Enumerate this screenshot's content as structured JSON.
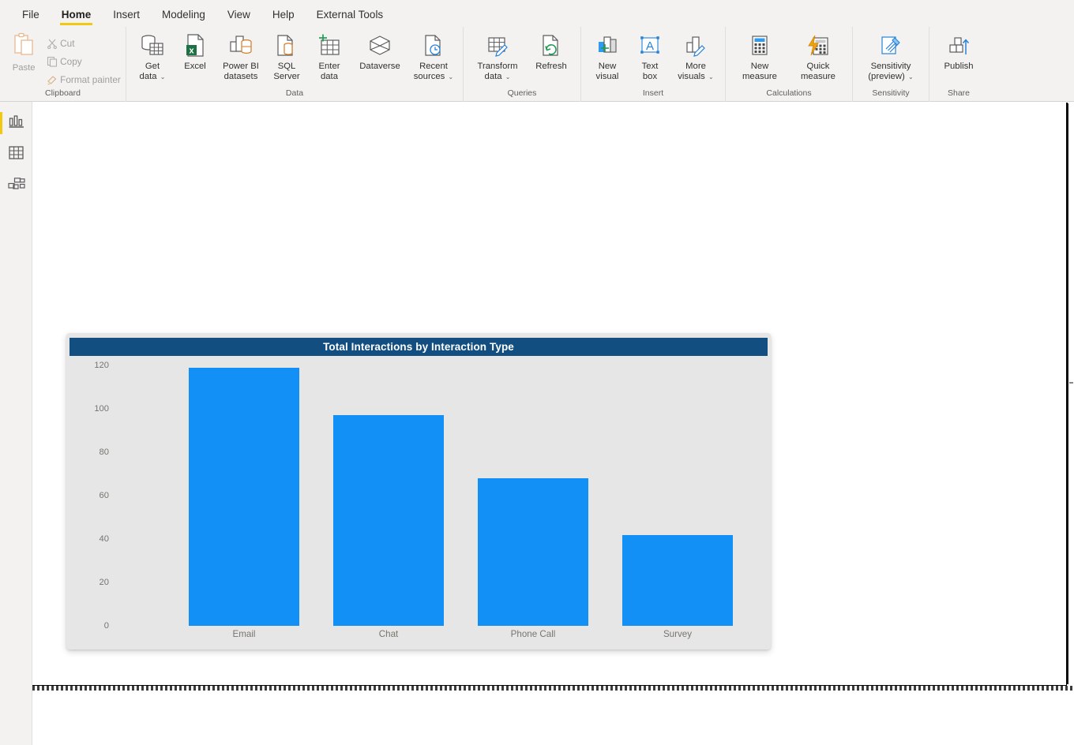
{
  "app": {
    "accent_color": "#f2c811",
    "ribbon_bg": "#f3f2f1"
  },
  "ribbon": {
    "tabs": [
      {
        "label": "File",
        "active": false
      },
      {
        "label": "Home",
        "active": true
      },
      {
        "label": "Insert",
        "active": false
      },
      {
        "label": "Modeling",
        "active": false
      },
      {
        "label": "View",
        "active": false
      },
      {
        "label": "Help",
        "active": false
      },
      {
        "label": "External Tools",
        "active": false
      }
    ],
    "groups": {
      "clipboard": {
        "label": "Clipboard",
        "paste": "Paste",
        "cut": "Cut",
        "copy": "Copy",
        "format_painter": "Format painter"
      },
      "data": {
        "label": "Data",
        "items": [
          {
            "label": "Get\ndata",
            "caret": true
          },
          {
            "label": "Excel",
            "caret": false
          },
          {
            "label": "Power BI\ndatasets",
            "caret": false
          },
          {
            "label": "SQL\nServer",
            "caret": false
          },
          {
            "label": "Enter\ndata",
            "caret": false
          },
          {
            "label": "Dataverse",
            "caret": false
          },
          {
            "label": "Recent\nsources",
            "caret": true
          }
        ]
      },
      "queries": {
        "label": "Queries",
        "items": [
          {
            "label": "Transform\ndata",
            "caret": true
          },
          {
            "label": "Refresh",
            "caret": false
          }
        ]
      },
      "insert": {
        "label": "Insert",
        "items": [
          {
            "label": "New\nvisual",
            "caret": false
          },
          {
            "label": "Text\nbox",
            "caret": false
          },
          {
            "label": "More\nvisuals",
            "caret": true
          }
        ]
      },
      "calculations": {
        "label": "Calculations",
        "items": [
          {
            "label": "New\nmeasure",
            "caret": false
          },
          {
            "label": "Quick\nmeasure",
            "caret": false
          }
        ]
      },
      "sensitivity": {
        "label": "Sensitivity",
        "items": [
          {
            "label": "Sensitivity\n(preview)",
            "caret": true
          }
        ]
      },
      "share": {
        "label": "Share",
        "items": [
          {
            "label": "Publish",
            "caret": false
          }
        ]
      }
    }
  },
  "rail": {
    "items": [
      {
        "name": "report-view",
        "active": true
      },
      {
        "name": "data-view",
        "active": false
      },
      {
        "name": "model-view",
        "active": false
      }
    ]
  },
  "chart_data": {
    "type": "bar",
    "title": "Total Interactions by Interaction Type",
    "categories": [
      "Email",
      "Chat",
      "Phone Call",
      "Survey"
    ],
    "values": [
      119,
      97,
      68,
      42
    ],
    "series": [
      {
        "name": "Total Interactions",
        "values": [
          119,
          97,
          68,
          42
        ]
      }
    ],
    "xlabel": "",
    "ylabel": "",
    "ylim": [
      0,
      120
    ],
    "yticks": [
      120,
      100,
      80,
      60,
      40,
      20,
      0
    ],
    "grid": false,
    "legend": null,
    "bar_color": "#1290f5",
    "plot_bg": "#e6e6e6",
    "title_bg": "#124e80",
    "title_color": "#ffffff",
    "axis_text_color": "#77756f"
  }
}
